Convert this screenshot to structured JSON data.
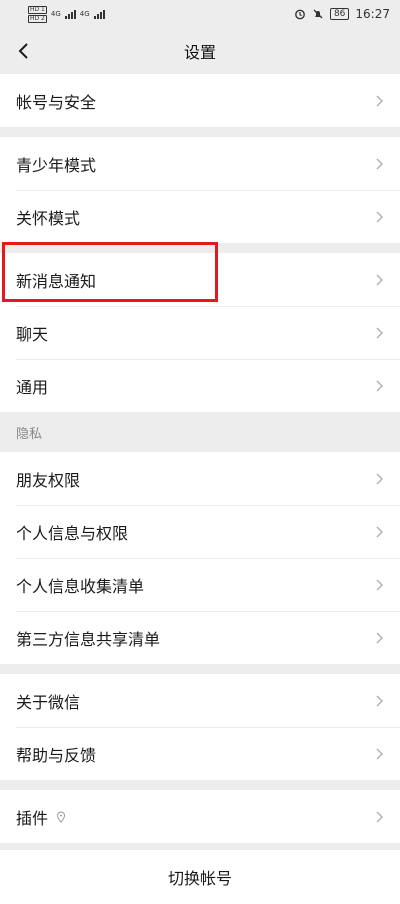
{
  "status_bar": {
    "sim1": "HD 1",
    "sim2": "HD 2",
    "net1": "4G",
    "net2": "4G",
    "battery": "86",
    "time": "16:27"
  },
  "nav": {
    "title": "设置"
  },
  "groups": [
    {
      "items": [
        {
          "label": "帐号与安全"
        }
      ]
    },
    {
      "items": [
        {
          "label": "青少年模式"
        },
        {
          "label": "关怀模式"
        }
      ]
    },
    {
      "items": [
        {
          "label": "新消息通知"
        },
        {
          "label": "聊天"
        },
        {
          "label": "通用"
        }
      ]
    }
  ],
  "privacy": {
    "header": "隐私",
    "items": [
      {
        "label": "朋友权限"
      },
      {
        "label": "个人信息与权限"
      },
      {
        "label": "个人信息收集清单"
      },
      {
        "label": "第三方信息共享清单"
      }
    ]
  },
  "about_group": {
    "items": [
      {
        "label": "关于微信"
      },
      {
        "label": "帮助与反馈"
      }
    ]
  },
  "plugins": {
    "label": "插件"
  },
  "switch_account": {
    "label": "切换帐号"
  },
  "colors": {
    "highlight": "#e5191c",
    "background": "#ededed"
  }
}
